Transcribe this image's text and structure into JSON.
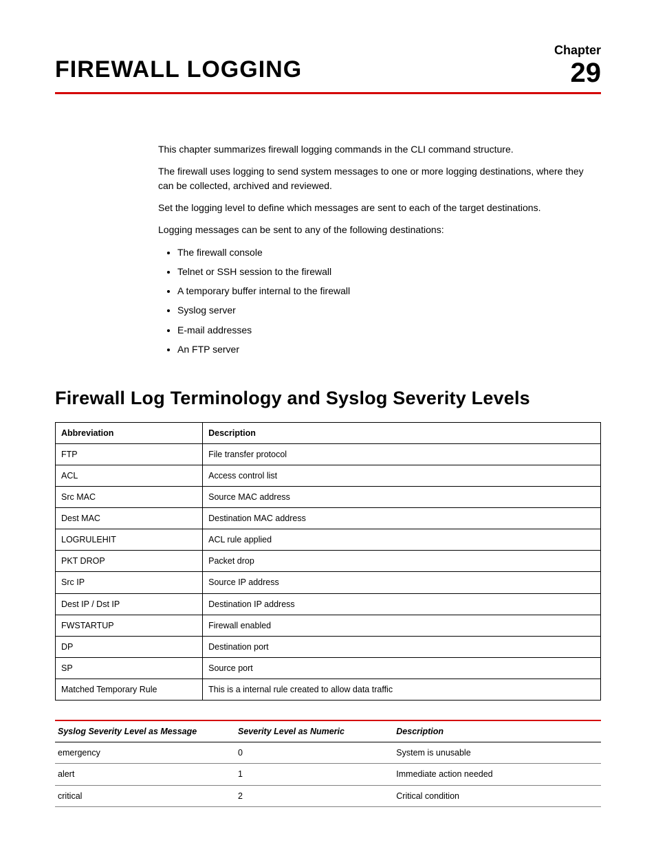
{
  "header": {
    "title": "FIREWALL LOGGING",
    "chapter_label": "Chapter",
    "chapter_number": "29"
  },
  "intro": {
    "p1": "This chapter summarizes firewall logging commands in the CLI command structure.",
    "p2": "The firewall uses logging to send system messages to one or more logging destinations, where they can be collected, archived and reviewed.",
    "p3": "Set the logging level to define which messages are sent to each of the target destinations.",
    "p4": "Logging messages can be sent to any of the following destinations:",
    "destinations": [
      "The firewall console",
      "Telnet or SSH session to the firewall",
      "A temporary buffer internal to the firewall",
      "Syslog server",
      "E-mail addresses",
      "An FTP server"
    ]
  },
  "section": {
    "title": "Firewall Log Terminology and Syslog Severity Levels"
  },
  "terms_table": {
    "headers": {
      "abbrev": "Abbreviation",
      "desc": "Description"
    },
    "rows": [
      {
        "abbrev": "FTP",
        "desc": "File transfer protocol"
      },
      {
        "abbrev": "ACL",
        "desc": "Access control list"
      },
      {
        "abbrev": "Src MAC",
        "desc": "Source MAC address"
      },
      {
        "abbrev": "Dest MAC",
        "desc": "Destination MAC address"
      },
      {
        "abbrev": "LOGRULEHIT",
        "desc": "ACL rule applied"
      },
      {
        "abbrev": "PKT DROP",
        "desc": "Packet drop"
      },
      {
        "abbrev": "Src IP",
        "desc": "Source IP address"
      },
      {
        "abbrev": "Dest IP / Dst IP",
        "desc": "Destination IP address"
      },
      {
        "abbrev": "FWSTARTUP",
        "desc": "Firewall enabled"
      },
      {
        "abbrev": "DP",
        "desc": "Destination port"
      },
      {
        "abbrev": "SP",
        "desc": "Source port"
      },
      {
        "abbrev": "Matched Temporary Rule",
        "desc": "This is a internal rule created to allow data traffic"
      }
    ]
  },
  "syslog_table": {
    "headers": {
      "msg": "Syslog Severity Level as Message",
      "num": "Severity Level as Numeric",
      "desc": "Description"
    },
    "rows": [
      {
        "msg": "emergency",
        "num": "0",
        "desc": "System is unusable"
      },
      {
        "msg": "alert",
        "num": "1",
        "desc": "Immediate action needed"
      },
      {
        "msg": "critical",
        "num": "2",
        "desc": "Critical condition"
      }
    ]
  }
}
